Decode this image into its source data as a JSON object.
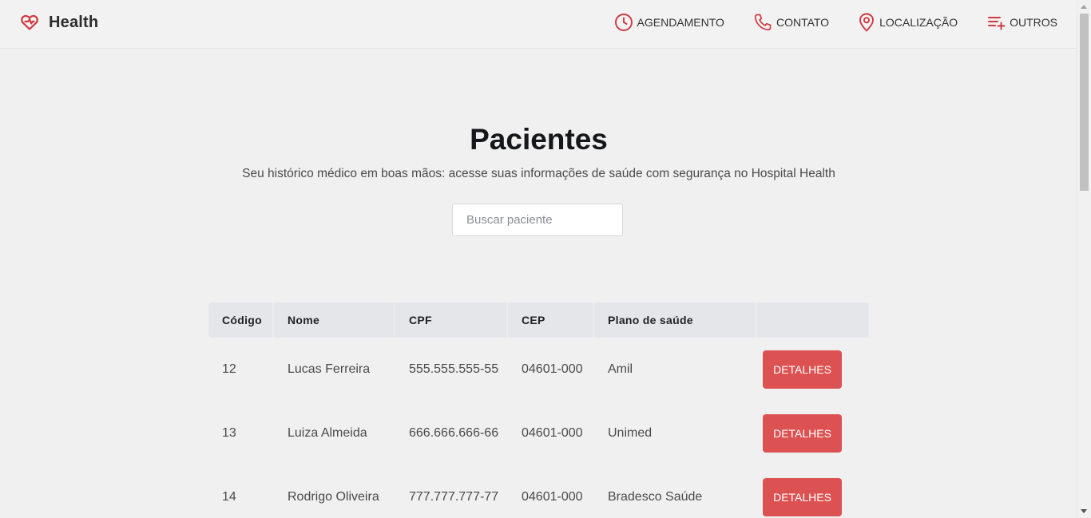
{
  "brand": {
    "name": "Health"
  },
  "nav": [
    {
      "label": "AGENDAMENTO",
      "icon": "clock-icon"
    },
    {
      "label": "CONTATO",
      "icon": "phone-icon"
    },
    {
      "label": "LOCALIZAÇÃO",
      "icon": "location-pin-icon"
    },
    {
      "label": "OUTROS",
      "icon": "list-plus-icon"
    }
  ],
  "hero": {
    "title": "Pacientes",
    "subtitle": "Seu histórico médico em boas mãos: acesse suas informações de saúde com segurança no Hospital Health"
  },
  "search": {
    "placeholder": "Buscar paciente",
    "value": ""
  },
  "table": {
    "columns": [
      "Código",
      "Nome",
      "CPF",
      "CEP",
      "Plano de saúde",
      ""
    ],
    "rows": [
      {
        "codigo": "12",
        "nome": "Lucas Ferreira",
        "cpf": "555.555.555-55",
        "cep": "04601-000",
        "plano": "Amil",
        "action": "DETALHES"
      },
      {
        "codigo": "13",
        "nome": "Luiza Almeida",
        "cpf": "666.666.666-66",
        "cep": "04601-000",
        "plano": "Unimed",
        "action": "DETALHES"
      },
      {
        "codigo": "14",
        "nome": "Rodrigo Oliveira",
        "cpf": "777.777.777-77",
        "cep": "04601-000",
        "plano": "Bradesco Saúde",
        "action": "DETALHES"
      }
    ]
  },
  "colors": {
    "accent": "#dc5252",
    "background": "#f0f0f0",
    "header_row": "#e5e6ea",
    "icon": "#d0373f"
  }
}
